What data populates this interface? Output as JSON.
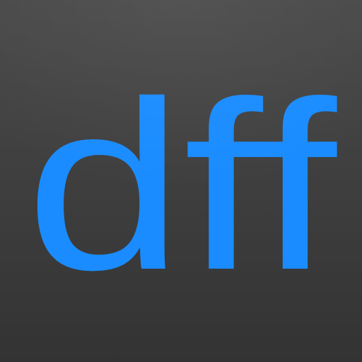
{
  "app_icon": {
    "text": "dff",
    "text_color": "#1a8cff",
    "background_color_top": "#4a4a4a",
    "background_color_bottom": "#333333"
  }
}
